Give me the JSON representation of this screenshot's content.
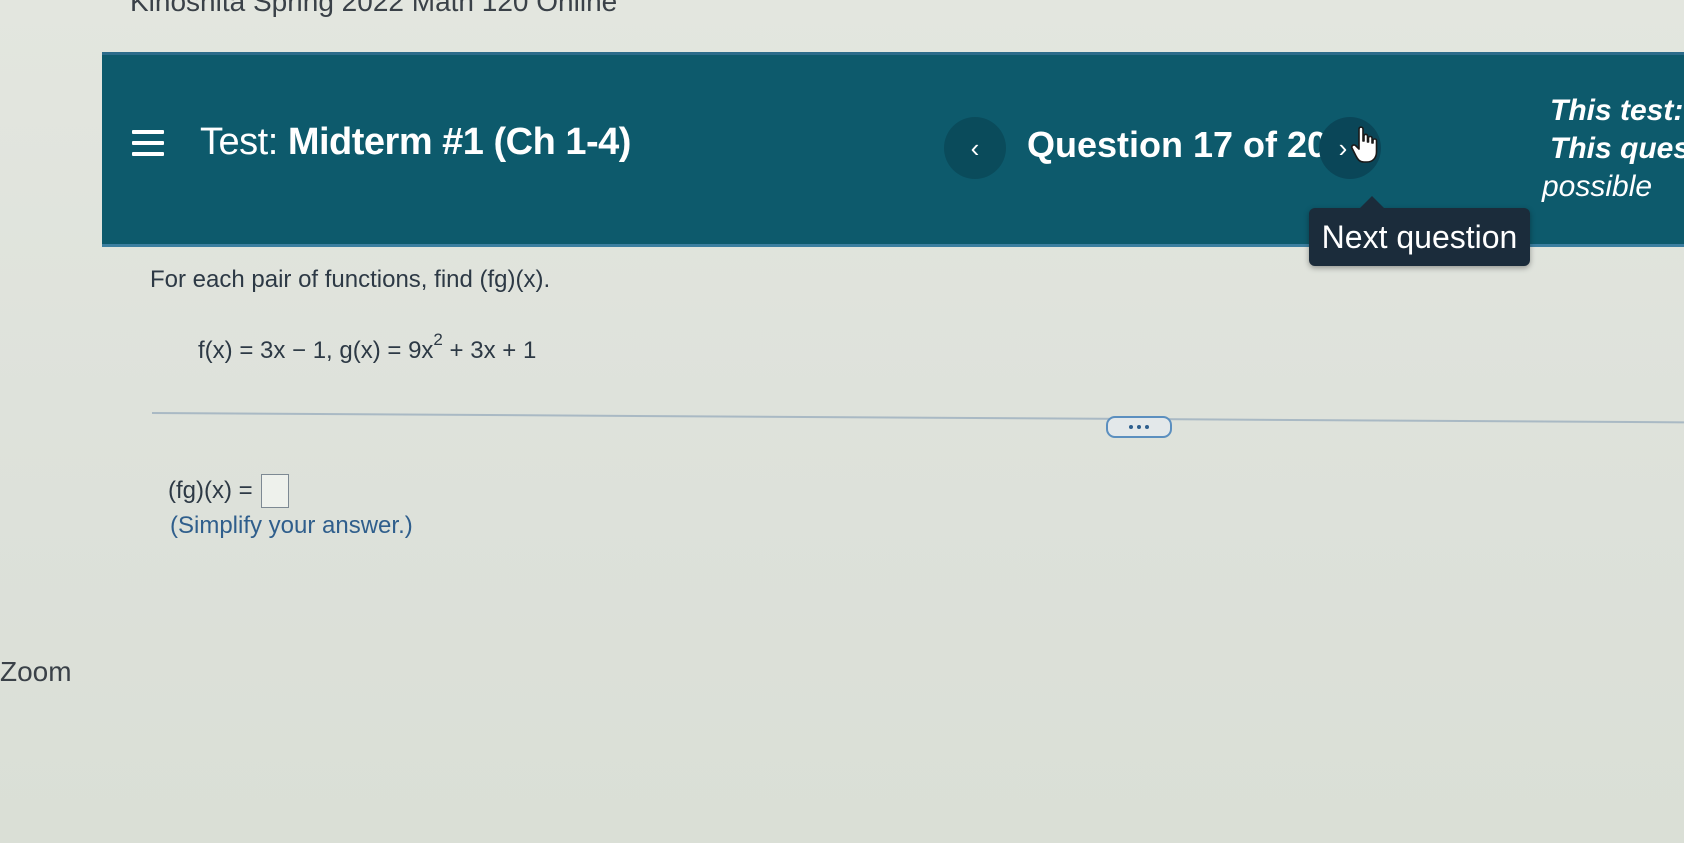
{
  "course": {
    "title": "Kinoshita Spring 2022 Math 120 Online"
  },
  "header": {
    "test_prefix": "Test:",
    "test_name": "Midterm #1 (Ch 1-4)",
    "question_counter": "Question 17 of 20",
    "prev_label": "‹",
    "next_label": "›",
    "info_line1": "This test:",
    "info_line2": "This ques",
    "info_line3": "possible",
    "bar_color": "#0d5a6c"
  },
  "tooltip": {
    "text": "Next question"
  },
  "question": {
    "prompt": "For each pair of functions, find (fg)(x).",
    "equation_part1": "f(x) = 3x − 1, g(x) = 9x",
    "equation_exp": "2",
    "equation_part2": " + 3x + 1",
    "answer_label": "(fg)(x) =",
    "answer_value": "",
    "hint": "(Simplify your answer.)"
  },
  "sidebar": {
    "zoom_label": "Zoom"
  },
  "icons": {
    "menu": "hamburger-menu-icon",
    "prev": "chevron-left-icon",
    "next": "chevron-right-icon",
    "cursor": "hand-pointer-icon",
    "more": "ellipsis-icon"
  }
}
